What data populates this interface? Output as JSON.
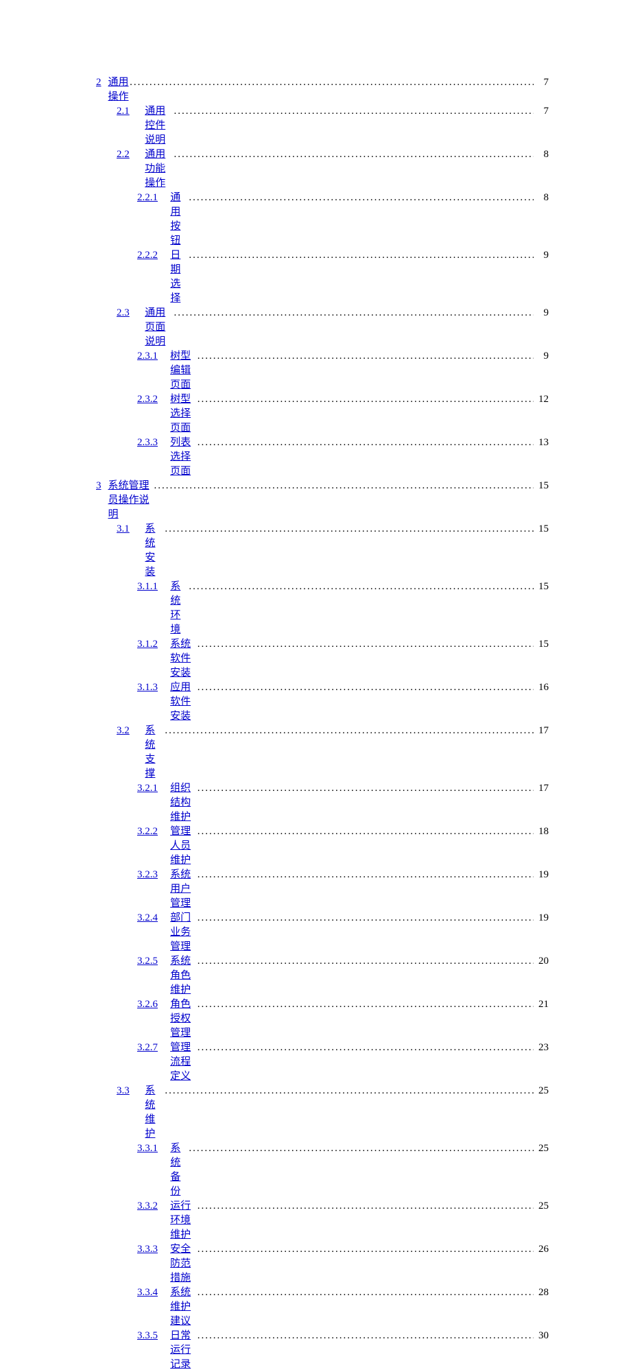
{
  "toc": [
    {
      "level": 1,
      "num": "2",
      "title": "通用操作",
      "page": "7"
    },
    {
      "level": 2,
      "num": "2.1",
      "title": "通用控件说明",
      "page": "7"
    },
    {
      "level": 2,
      "num": "2.2",
      "title": "通用功能操作",
      "page": "8"
    },
    {
      "level": 3,
      "num": "2.2.1",
      "title": "通用按钮",
      "page": "8"
    },
    {
      "level": 3,
      "num": "2.2.2",
      "title": "日期选择",
      "page": "9"
    },
    {
      "level": 2,
      "num": "2.3",
      "title": "通用页面说明",
      "page": "9"
    },
    {
      "level": 3,
      "num": "2.3.1",
      "title": "树型编辑页面",
      "page": "9"
    },
    {
      "level": 3,
      "num": "2.3.2",
      "title": "树型选择页面",
      "page": "12"
    },
    {
      "level": 3,
      "num": "2.3.3",
      "title": "列表选择页面",
      "page": "13"
    },
    {
      "level": 1,
      "num": "3",
      "title": "系统管理员操作说明",
      "page": "15"
    },
    {
      "level": 2,
      "num": "3.1",
      "title": "系统安装",
      "page": "15"
    },
    {
      "level": 3,
      "num": "3.1.1",
      "title": "系统环境",
      "page": "15"
    },
    {
      "level": 3,
      "num": "3.1.2",
      "title": "系统软件安装",
      "page": "15"
    },
    {
      "level": 3,
      "num": "3.1.3",
      "title": "应用软件安装",
      "page": "16"
    },
    {
      "level": 2,
      "num": "3.2",
      "title": "系统支撑",
      "page": "17"
    },
    {
      "level": 3,
      "num": "3.2.1",
      "title": "组织结构维护",
      "page": "17"
    },
    {
      "level": 3,
      "num": "3.2.2",
      "title": "管理人员维护",
      "page": "18"
    },
    {
      "level": 3,
      "num": "3.2.3",
      "title": "系统用户管理",
      "page": "19"
    },
    {
      "level": 3,
      "num": "3.2.4",
      "title": "部门业务管理",
      "page": "19"
    },
    {
      "level": 3,
      "num": "3.2.5",
      "title": "系统角色维护",
      "page": "20"
    },
    {
      "level": 3,
      "num": "3.2.6",
      "title": "角色授权管理",
      "page": "21"
    },
    {
      "level": 3,
      "num": "3.2.7",
      "title": "管理流程定义",
      "page": "23"
    },
    {
      "level": 2,
      "num": "3.3",
      "title": "系统维护",
      "page": "25"
    },
    {
      "level": 3,
      "num": "3.3.1",
      "title": "系统备份",
      "page": "25"
    },
    {
      "level": 3,
      "num": "3.3.2",
      "title": "运行环境维护",
      "page": "25"
    },
    {
      "level": 3,
      "num": "3.3.3",
      "title": "安全防范措施",
      "page": "26"
    },
    {
      "level": 3,
      "num": "3.3.4",
      "title": "系统维护建议",
      "page": "28"
    },
    {
      "level": 3,
      "num": "3.3.5",
      "title": "日常运行记录",
      "page": "30"
    }
  ]
}
